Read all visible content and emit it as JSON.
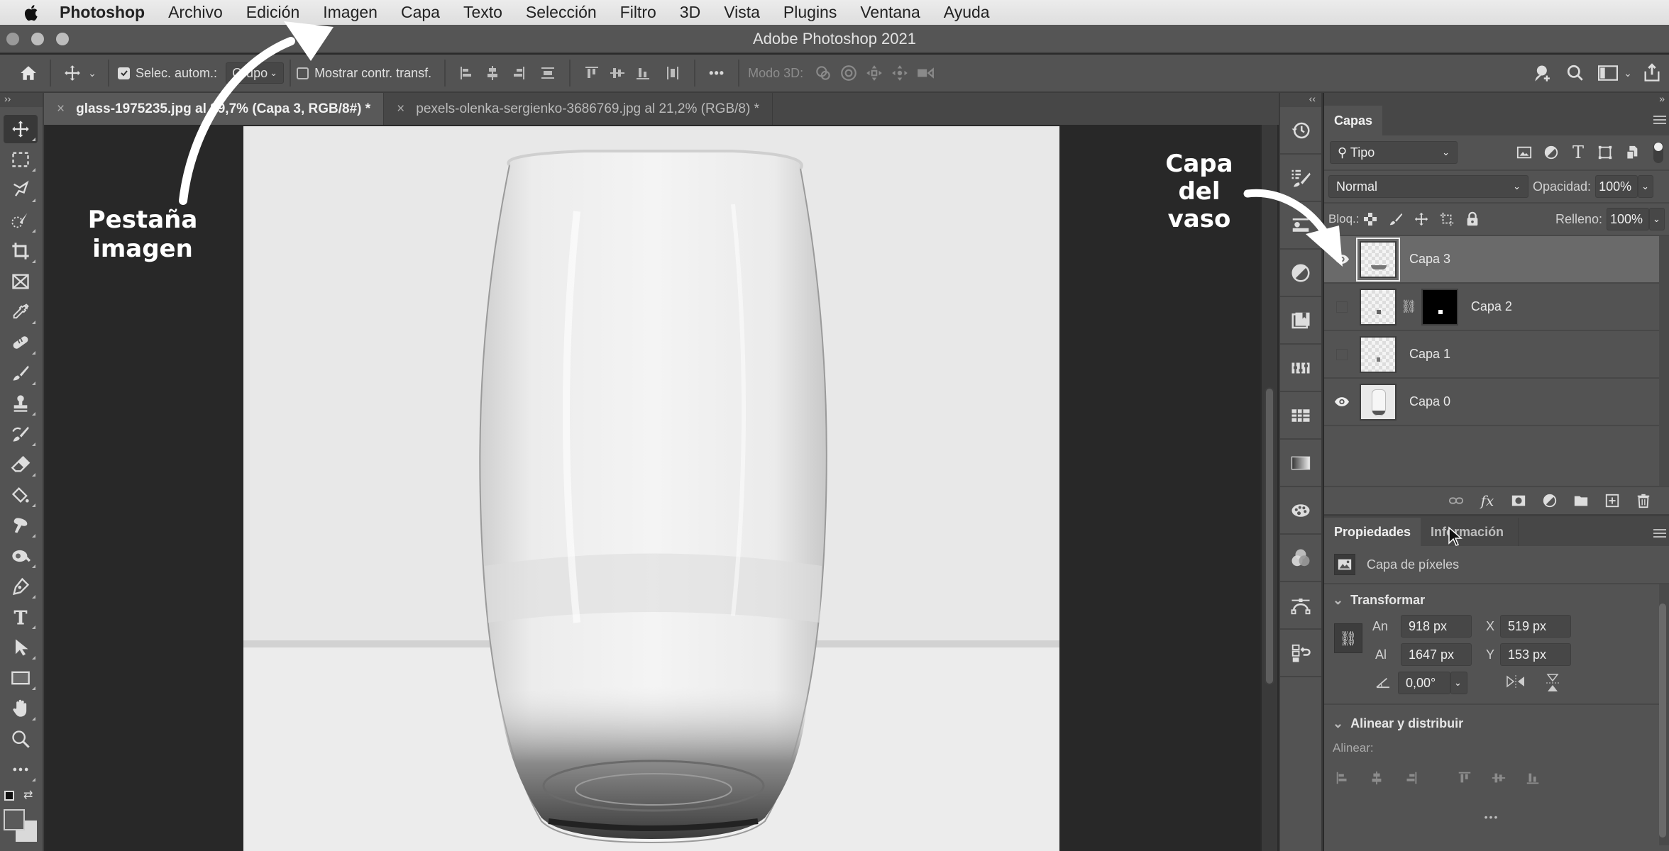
{
  "menubar": {
    "app": "Photoshop",
    "items": [
      "Archivo",
      "Edición",
      "Imagen",
      "Capa",
      "Texto",
      "Selección",
      "Filtro",
      "3D",
      "Vista",
      "Plugins",
      "Ventana",
      "Ayuda"
    ]
  },
  "window": {
    "title": "Adobe Photoshop 2021"
  },
  "options_bar": {
    "auto_select_label": "Selec. autom.:",
    "auto_select_checked": true,
    "auto_select_target": "Grupo",
    "show_transform_label": "Mostrar contr. transf.",
    "show_transform_checked": false,
    "more": "•••",
    "mode_3d_label": "Modo 3D:"
  },
  "tabs": [
    {
      "close": "×",
      "label": "glass-1975235.jpg al 89,7% (Capa 3, RGB/8#) *",
      "active": true
    },
    {
      "close": "×",
      "label": "pexels-olenka-sergienko-3686769.jpg al 21,2% (RGB/8) *",
      "active": false
    }
  ],
  "toolbar": {
    "collapse": "››",
    "tools": [
      "move",
      "rectangular-marquee",
      "lasso",
      "quick-selection",
      "crop",
      "frame",
      "eyedropper",
      "healing-brush",
      "brush",
      "clone-stamp",
      "history-brush",
      "eraser",
      "paint-bucket",
      "smudge",
      "dodge",
      "pen",
      "type",
      "path-selection",
      "rectangle",
      "hand",
      "zoom",
      "more"
    ],
    "foreground_color": "#5a5a5a",
    "background_color": "#d9d9d9"
  },
  "icon_strip": {
    "collapse": "‹‹",
    "items": [
      "history",
      "brush-settings",
      "swatches-library",
      "adjustments",
      "libraries",
      "channels-mixer",
      "swatches",
      "gradients",
      "color-palette",
      "color-wheel",
      "paths",
      "actions"
    ]
  },
  "layers_panel": {
    "title": "Capas",
    "filter_label": "Tipo",
    "blend_mode": "Normal",
    "opacity_label": "Opacidad:",
    "opacity_value": "100%",
    "lock_label": "Bloq.:",
    "fill_label": "Relleno:",
    "fill_value": "100%",
    "layers": [
      {
        "name": "Capa 3",
        "visible": true,
        "selected": true,
        "has_mask": false
      },
      {
        "name": "Capa 2",
        "visible": false,
        "selected": false,
        "has_mask": true
      },
      {
        "name": "Capa 1",
        "visible": false,
        "selected": false,
        "has_mask": false
      },
      {
        "name": "Capa 0",
        "visible": true,
        "selected": false,
        "has_mask": false
      }
    ]
  },
  "properties_panel": {
    "tabs": [
      "Propiedades",
      "Información"
    ],
    "layer_type": "Capa de píxeles",
    "transform": {
      "title": "Transformar",
      "width_label": "An",
      "width": "918 px",
      "height_label": "Al",
      "height": "1647 px",
      "x_label": "X",
      "x": "519 px",
      "y_label": "Y",
      "y": "153 px",
      "angle": "0,00°"
    },
    "align": {
      "title": "Alinear y distribuir",
      "label": "Alinear:",
      "more": "•••"
    }
  },
  "annotations": {
    "tab_note": [
      "Pestaña",
      "imagen"
    ],
    "layer_note": [
      "Capa",
      "del",
      "vaso"
    ]
  }
}
